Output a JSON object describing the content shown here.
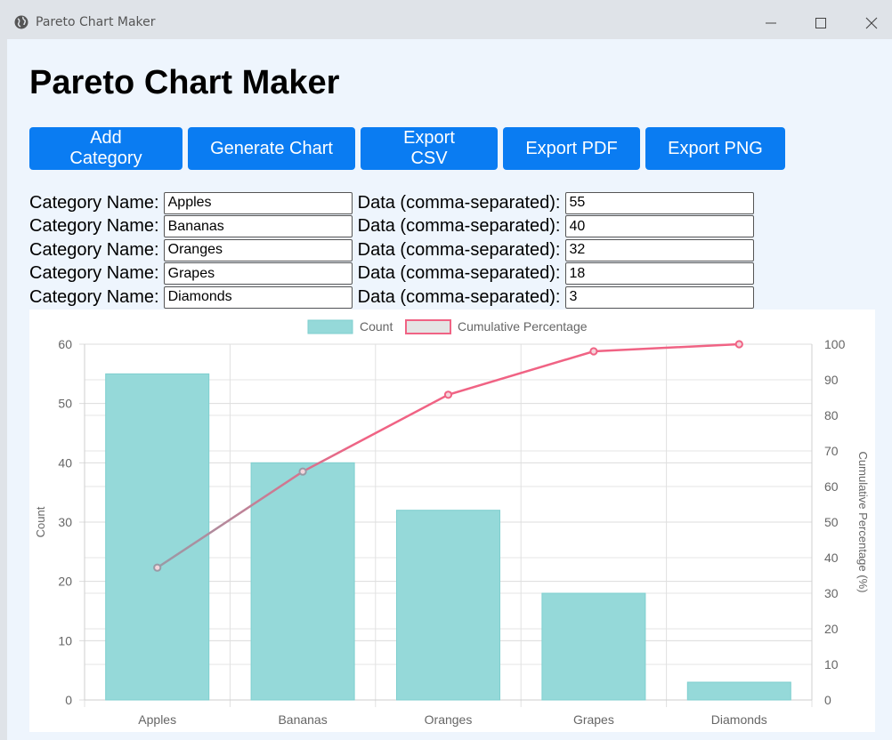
{
  "window": {
    "title": "Pareto Chart Maker"
  },
  "page": {
    "heading": "Pareto Chart Maker"
  },
  "toolbar": {
    "add_category": "Add Category",
    "generate_chart": "Generate Chart",
    "export_csv": "Export CSV",
    "export_pdf": "Export PDF",
    "export_png": "Export PNG"
  },
  "form": {
    "name_label": "Category Name:",
    "data_label": "Data (comma-separated):",
    "rows": [
      {
        "name": "Apples",
        "data": "55"
      },
      {
        "name": "Bananas",
        "data": "40"
      },
      {
        "name": "Oranges",
        "data": "32"
      },
      {
        "name": "Grapes",
        "data": "18"
      },
      {
        "name": "Diamonds",
        "data": "3"
      }
    ]
  },
  "colors": {
    "bar_fill": "#95d9d9",
    "bar_stroke": "#7fcfcf",
    "line": "#f06384",
    "button": "#0a7cf2"
  },
  "chart_data": {
    "type": "bar",
    "categories": [
      "Apples",
      "Bananas",
      "Oranges",
      "Grapes",
      "Diamonds"
    ],
    "series": [
      {
        "name": "Count",
        "type": "bar",
        "axis": "left",
        "values": [
          55,
          40,
          32,
          18,
          3
        ]
      },
      {
        "name": "Cumulative Percentage",
        "type": "line",
        "axis": "right",
        "values": [
          37.2,
          64.2,
          85.8,
          98.0,
          100.0
        ]
      }
    ],
    "ylabel": "Count",
    "y2label": "Cumulative Percentage (%)",
    "ylim": [
      0,
      60
    ],
    "y2lim": [
      0,
      100
    ],
    "yticks": [
      0,
      10,
      20,
      30,
      40,
      50,
      60
    ],
    "y2ticks": [
      0,
      10,
      20,
      30,
      40,
      50,
      60,
      70,
      80,
      90,
      100
    ],
    "grid": true,
    "legend": "top-center"
  }
}
